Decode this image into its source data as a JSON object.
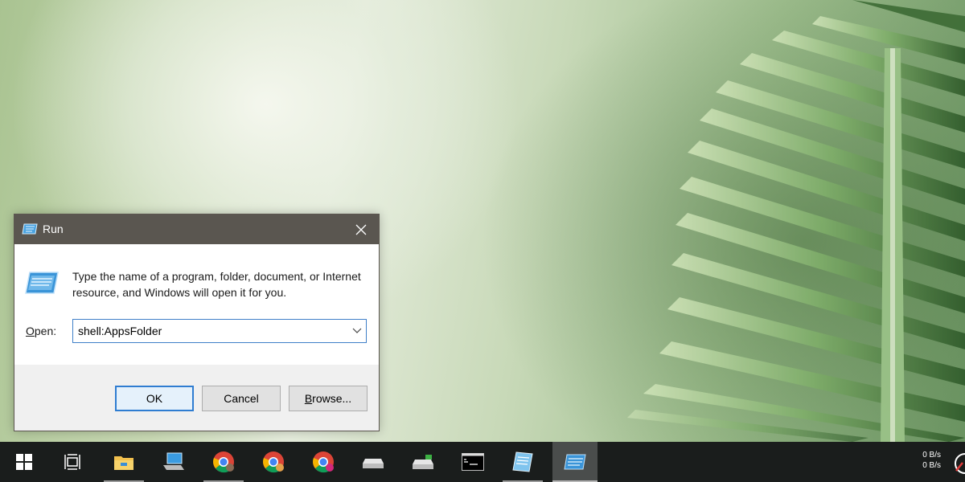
{
  "dialog": {
    "title": "Run",
    "description": "Type the name of a program, folder, document, or Internet resource, and Windows will open it for you.",
    "open_label_underlined": "O",
    "open_label_rest": "pen:",
    "open_value": "shell:AppsFolder",
    "ok_label": "OK",
    "cancel_label": "Cancel",
    "browse_label_underlined": "B",
    "browse_label_rest": "rowse..."
  },
  "taskbar": {
    "items": [
      {
        "icon": "windows-start-icon"
      },
      {
        "icon": "task-view-icon"
      },
      {
        "icon": "file-explorer-icon",
        "running": true
      },
      {
        "icon": "this-pc-icon"
      },
      {
        "icon": "chrome-icon",
        "running": true
      },
      {
        "icon": "chrome-icon"
      },
      {
        "icon": "chrome-icon"
      },
      {
        "icon": "drive-icon"
      },
      {
        "icon": "drive-icon"
      },
      {
        "icon": "command-prompt-icon"
      },
      {
        "icon": "notepad-icon",
        "running": true
      },
      {
        "icon": "run-icon",
        "active": true
      }
    ],
    "net_up": "0 B/s",
    "net_down": "0 B/s"
  },
  "colors": {
    "titlebar": "#5a5650",
    "taskbar": "#1a1d1c",
    "accent": "#2f7dd1"
  }
}
